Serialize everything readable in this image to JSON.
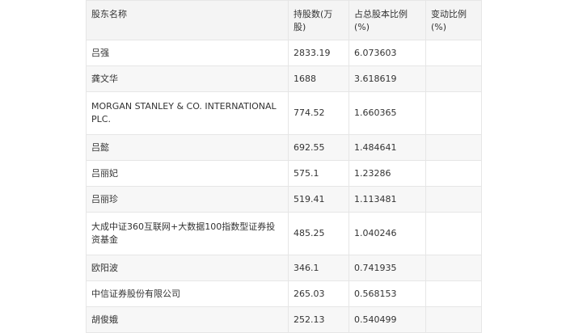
{
  "table": {
    "headers": [
      "股东名称",
      "持股数(万股)",
      "占总股本比例(%)",
      "变动比例(%)"
    ],
    "rows": [
      {
        "name": "吕强",
        "shares": "2833.19",
        "ratio": "6.073603",
        "change": ""
      },
      {
        "name": "龚文华",
        "shares": "1688",
        "ratio": "3.618619",
        "change": ""
      },
      {
        "name": "MORGAN STANLEY & CO. INTERNATIONAL PLC.",
        "shares": "774.52",
        "ratio": "1.660365",
        "change": ""
      },
      {
        "name": "吕懿",
        "shares": "692.55",
        "ratio": "1.484641",
        "change": ""
      },
      {
        "name": "吕丽妃",
        "shares": "575.1",
        "ratio": "1.23286",
        "change": ""
      },
      {
        "name": "吕丽珍",
        "shares": "519.41",
        "ratio": "1.113481",
        "change": ""
      },
      {
        "name": "大成中证360互联网+大数据100指数型证券投资基金",
        "shares": "485.25",
        "ratio": "1.040246",
        "change": ""
      },
      {
        "name": "欧阳波",
        "shares": "346.1",
        "ratio": "0.741935",
        "change": ""
      },
      {
        "name": "中信证券股份有限公司",
        "shares": "265.03",
        "ratio": "0.568153",
        "change": ""
      },
      {
        "name": "胡俊娥",
        "shares": "252.13",
        "ratio": "0.540499",
        "change": ""
      }
    ]
  }
}
